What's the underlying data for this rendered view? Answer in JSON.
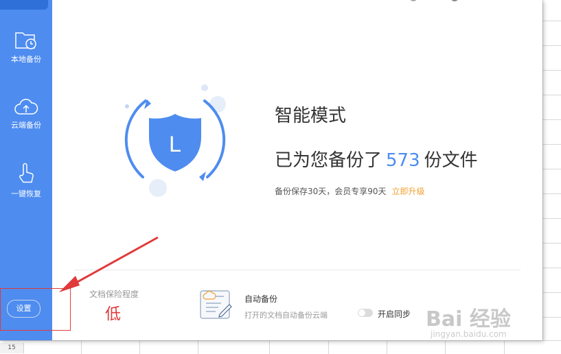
{
  "sidebar": {
    "items": [
      {
        "label": "本地备份",
        "icon": "folder-clock-icon"
      },
      {
        "label": "云端备份",
        "icon": "cloud-upload-icon"
      },
      {
        "label": "一键恢复",
        "icon": "hand-tap-icon"
      }
    ],
    "settings_label": "设置"
  },
  "main": {
    "mode_title": "智能模式",
    "backup_prefix": "已为您备份了",
    "backup_count": "573",
    "backup_suffix": "份文件",
    "retention_text": "备份保存30天，会员专享90天",
    "upgrade_link": "立即升级",
    "shield_letter": "L"
  },
  "footer": {
    "protect_label": "文档保险程度",
    "protect_value": "低",
    "auto_backup_title": "自动备份",
    "auto_backup_desc": "打开的文档自动备份云端",
    "sync_toggle_label": "开启同步",
    "sync_enabled": false
  },
  "sheet": {
    "row_number": "15"
  },
  "watermark": {
    "main": "Bai 经验",
    "sub": "jingyan.baidu.com"
  },
  "colors": {
    "sidebar": "#4e8cf0",
    "accent": "#4e8cf0",
    "upgrade": "#f0a030",
    "danger": "#e03a3a"
  }
}
